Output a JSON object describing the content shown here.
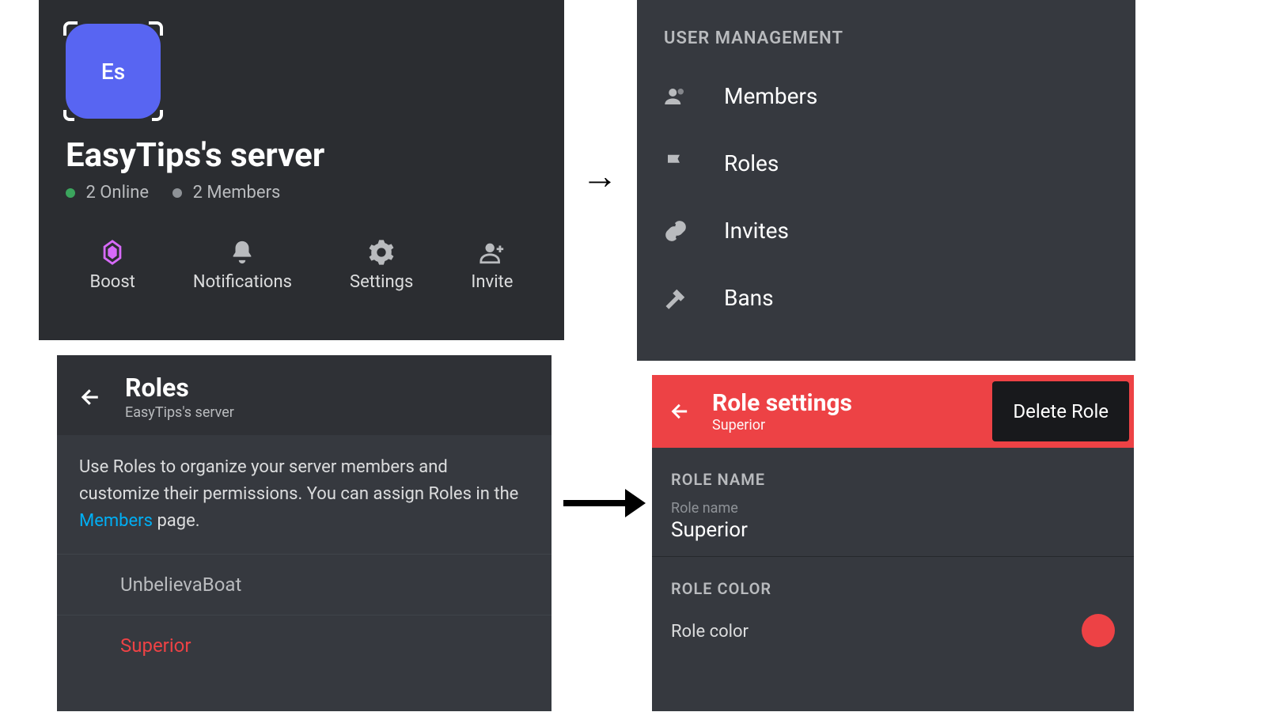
{
  "server": {
    "icon_initials": "Es",
    "name": "EasyTips's server",
    "online_count": "2 Online",
    "member_count": "2 Members",
    "online_dot": "#3ba55d",
    "member_dot": "#8e9297",
    "actions": {
      "boost": "Boost",
      "notifications": "Notifications",
      "settings": "Settings",
      "invite": "Invite"
    }
  },
  "user_mgmt": {
    "header": "USER MANAGEMENT",
    "items": [
      "Members",
      "Roles",
      "Invites",
      "Bans"
    ]
  },
  "roles": {
    "title": "Roles",
    "subtitle": "EasyTips's server",
    "desc_pre": "Use Roles to organize your server members and customize their permissions. You can assign Roles in the ",
    "desc_link": "Members",
    "desc_post": " page.",
    "list": [
      {
        "name": "UnbelievaBoat",
        "color": "#b9bbbe"
      },
      {
        "name": "Superior",
        "color": "#ed4245"
      }
    ]
  },
  "role_settings": {
    "title": "Role settings",
    "subtitle": "Superior",
    "delete_label": "Delete Role",
    "name_section": "ROLE NAME",
    "name_field_label": "Role name",
    "name_value": "Superior",
    "color_section": "ROLE COLOR",
    "color_field_label": "Role color",
    "color_value": "#ed4245"
  }
}
